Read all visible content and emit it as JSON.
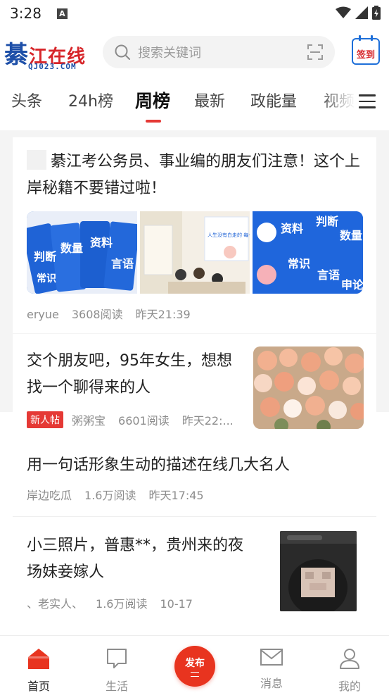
{
  "status_bar": {
    "time": "3:28",
    "notification_glyph": "A"
  },
  "header": {
    "logo_main": "江在线",
    "logo_big_char": "綦",
    "logo_domain": "QJ023.COM",
    "search_placeholder": "搜索关键词",
    "signin_label": "签到"
  },
  "tabs": [
    {
      "label": "头条"
    },
    {
      "label": "24h榜"
    },
    {
      "label": "周榜"
    },
    {
      "label": "最新"
    },
    {
      "label": "政能量"
    },
    {
      "label": "视频"
    }
  ],
  "active_tab": "周榜",
  "posts": [
    {
      "title": "綦江考公务员、事业编的朋友们注意！这个上岸秘籍不要错过啦！",
      "author": "eryue",
      "reads": "3608阅读",
      "time": "昨天21:39",
      "image1_text": [
        "资料",
        "数量",
        "判断",
        "常识",
        "言语"
      ],
      "image2_text": "人生没有白走的 每一步都算数",
      "image3_text": [
        "资料",
        "判断",
        "数量",
        "常识",
        "言语",
        "申论"
      ]
    },
    {
      "title": "交个朋友吧，95年女生，想想找一个聊得来的人",
      "badge": "新人帖",
      "author": "粥粥宝",
      "reads": "6601阅读",
      "time": "昨天22:..."
    },
    {
      "title": "用一句话形象生动的描述在线几大名人",
      "author": "岸边吃瓜",
      "reads": "1.6万阅读",
      "time": "昨天17:45"
    },
    {
      "title": "小三照片，普惠**，贵州来的夜场妹妾嫁人",
      "author": "、老实人、",
      "reads": "1.6万阅读",
      "time": "10-17"
    }
  ],
  "bottom_nav": {
    "home": "首页",
    "life": "生活",
    "publish": "发布",
    "messages": "消息",
    "me": "我的"
  },
  "colors": {
    "accent": "#e53935",
    "brand_blue": "#1d4fa8",
    "publish": "#e8341f"
  }
}
